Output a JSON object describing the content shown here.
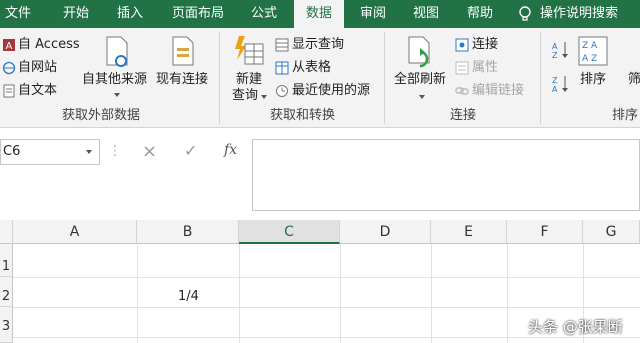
{
  "tabs": [
    "文件",
    "开始",
    "插入",
    "页面布局",
    "公式",
    "数据",
    "审阅",
    "视图",
    "帮助"
  ],
  "tell_me": "操作说明搜索",
  "ribbon": {
    "get_external": {
      "access": "自 Access",
      "web": "自网站",
      "text": "自文本",
      "other_sources": "自其他来源",
      "existing_connections": "现有连接",
      "group_label": "获取外部数据"
    },
    "get_transform": {
      "new_query_line1": "新建",
      "new_query_line2": "查询",
      "show_queries": "显示查询",
      "from_table": "从表格",
      "recent_sources": "最近使用的源",
      "group_label": "获取和转换"
    },
    "connections": {
      "refresh_all": "全部刷新",
      "connections": "连接",
      "properties": "属性",
      "edit_links": "编辑链接",
      "group_label": "连接"
    },
    "sort_filter": {
      "sort": "排序",
      "filter": "筛",
      "group_label": "排序"
    }
  },
  "formula_bar": {
    "name_box": "C6",
    "cancel_icon": "×",
    "enter_icon": "✓",
    "fx": "fx",
    "value": ""
  },
  "grid": {
    "columns": [
      "A",
      "B",
      "C",
      "D",
      "E",
      "F",
      "G"
    ],
    "selected_column": "C",
    "rows": [
      "1",
      "2",
      "3"
    ],
    "cells": {
      "B2": "1/4"
    }
  },
  "watermark": "头条 @张果断",
  "colors": {
    "accent": "#217346",
    "ribbon_bg": "#f3f3f3"
  }
}
